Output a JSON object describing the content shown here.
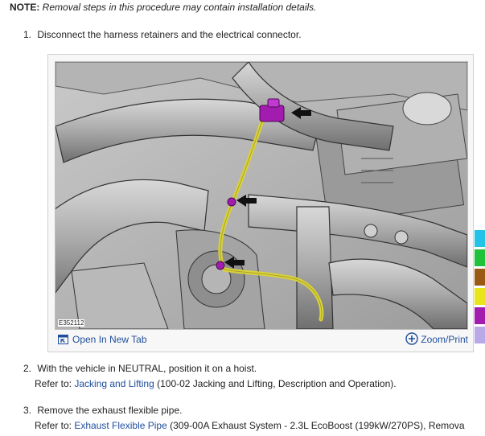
{
  "note": {
    "label": "NOTE:",
    "text": " Removal steps in this procedure may contain installation details."
  },
  "steps": [
    {
      "num": "1.",
      "text": "Disconnect the harness retainers and the electrical connector."
    },
    {
      "num": "2.",
      "text": "With the vehicle in NEUTRAL, position it on a hoist.",
      "refer_prefix": "Refer to: ",
      "link": "Jacking and Lifting",
      "refer_suffix": " (100-02 Jacking and Lifting, Description and Operation)."
    },
    {
      "num": "3.",
      "text": "Remove the exhaust flexible pipe.",
      "refer_prefix": "Refer to: ",
      "link": "Exhaust Flexible Pipe",
      "refer_suffix": " (309-00A Exhaust System - 2.3L EcoBoost (199kW/270PS), Remova"
    }
  ],
  "figure": {
    "label": "E352112",
    "open_tab": "Open In New Tab",
    "zoom": "Zoom/Print"
  },
  "colors": {
    "link": "#1f4e9c",
    "connector": "#a21caf",
    "harness": "#d9d23a",
    "swatches": [
      "#22c3e6",
      "#1fc23a",
      "#9a5a14",
      "#e8e61a",
      "#a21caf",
      "#b9a9e8"
    ]
  }
}
